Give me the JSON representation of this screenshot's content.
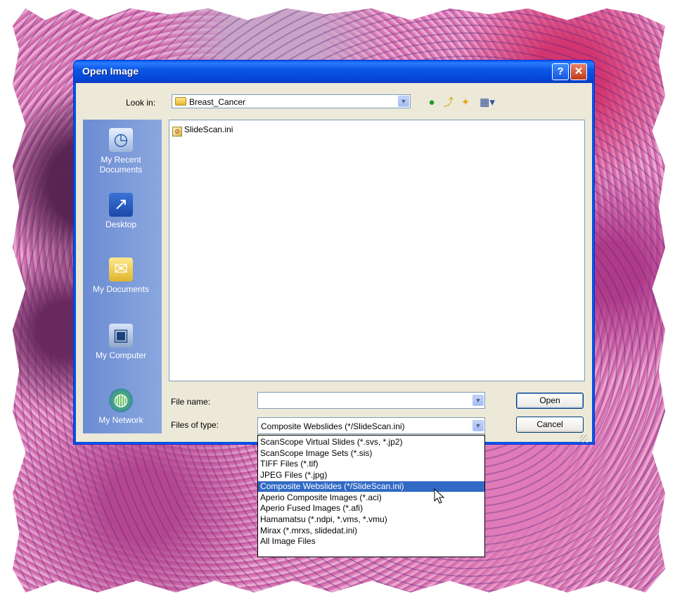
{
  "dialog": {
    "title": "Open Image",
    "help_label": "?",
    "close_label": "✕"
  },
  "lookin": {
    "label": "Look in:",
    "value": "Breast_Cancer"
  },
  "places": [
    {
      "label": "My Recent Documents",
      "icon": "recent-documents-icon"
    },
    {
      "label": "Desktop",
      "icon": "desktop-icon"
    },
    {
      "label": "My Documents",
      "icon": "my-documents-icon"
    },
    {
      "label": "My Computer",
      "icon": "my-computer-icon"
    },
    {
      "label": "My Network",
      "icon": "my-network-icon"
    }
  ],
  "files": [
    {
      "name": "SlideScan.ini",
      "icon": "ini-file-icon"
    }
  ],
  "filename": {
    "label": "File name:",
    "value": ""
  },
  "filetype": {
    "label": "Files of type:",
    "value": "Composite Webslides (*/SlideScan.ini)",
    "options": [
      "ScanScope Virtual Slides (*.svs, *.jp2)",
      "ScanScope Image Sets (*.sis)",
      "TIFF Files (*.tif)",
      "JPEG Files (*.jpg)",
      "Composite Webslides (*/SlideScan.ini)",
      "Aperio Composite Images (*.aci)",
      "Aperio Fused Images (*.afi)",
      "Hamamatsu (*.ndpi, *.vms, *.vmu)",
      "Mirax (*.mrxs, slidedat.ini)",
      "All Image Files"
    ],
    "selected_index": 4
  },
  "buttons": {
    "open": "Open",
    "cancel": "Cancel"
  },
  "colors": {
    "titlebar": "#0054e3",
    "selection": "#316ac5",
    "places_bar": "#7d9bd6"
  }
}
